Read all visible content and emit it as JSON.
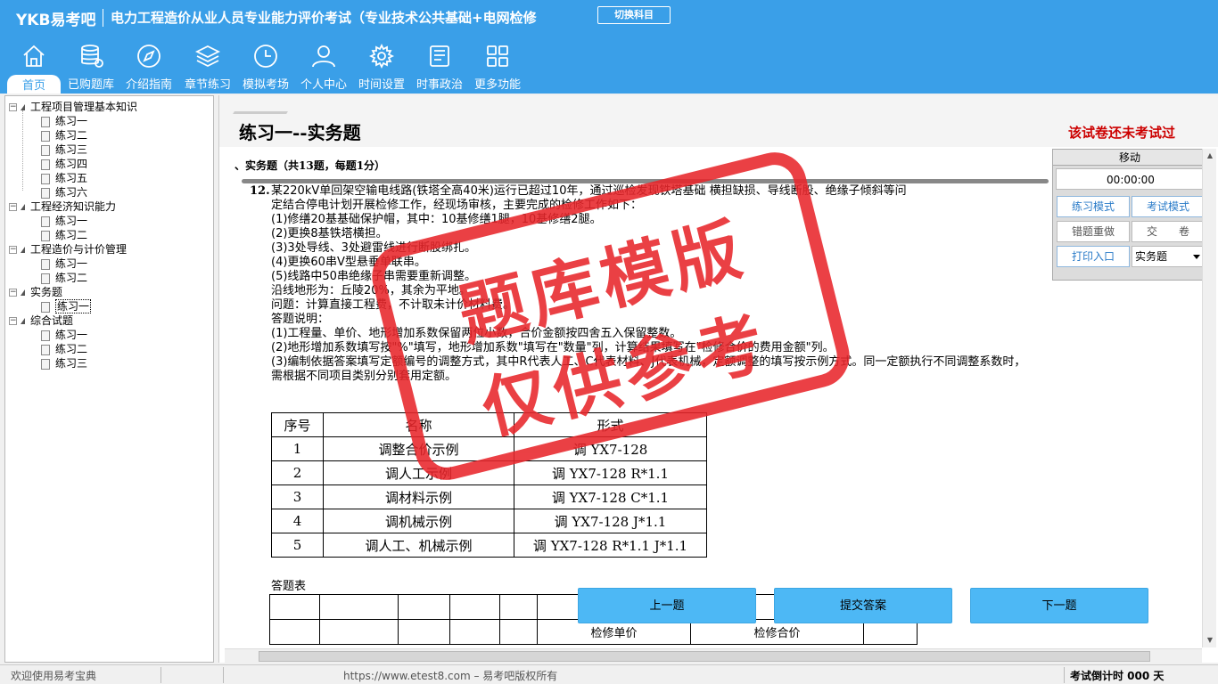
{
  "header": {
    "logo": "YKB易考吧",
    "title": "电力工程造价从业人员专业能力评价考试（专业技术公共基础+电网检修",
    "switch_label": "切换科目",
    "nav": [
      {
        "label": "首页",
        "icon": "home-icon",
        "active": true
      },
      {
        "label": "已购题库",
        "icon": "database-icon"
      },
      {
        "label": "介绍指南",
        "icon": "compass-icon"
      },
      {
        "label": "章节练习",
        "icon": "layers-icon"
      },
      {
        "label": "模拟考场",
        "icon": "clock-icon"
      },
      {
        "label": "个人中心",
        "icon": "user-icon"
      },
      {
        "label": "时间设置",
        "icon": "gear-icon"
      },
      {
        "label": "时事政治",
        "icon": "news-icon"
      },
      {
        "label": "更多功能",
        "icon": "grid-icon"
      }
    ]
  },
  "sidebar": {
    "groups": [
      {
        "label": "工程项目管理基本知识",
        "items": [
          "练习一",
          "练习二",
          "练习三",
          "练习四",
          "练习五",
          "练习六"
        ]
      },
      {
        "label": "工程经济知识能力",
        "items": [
          "练习一",
          "练习二"
        ]
      },
      {
        "label": "工程造价与计价管理",
        "items": [
          "练习一",
          "练习二"
        ]
      },
      {
        "label": "实务题",
        "items": [
          "练习一"
        ]
      },
      {
        "label": "综合试题",
        "items": [
          "练习一",
          "练习二",
          "练习三"
        ]
      }
    ],
    "selected": "实务题/练习一"
  },
  "content": {
    "paper_title": "练习一--实务题",
    "status": "该试卷还未考试过",
    "section_title": "、实务题（共13题，每题1分）",
    "question": {
      "number": "12.",
      "lines": [
        "某220kV单回架空输电线路(铁塔全高40米)运行已超过10年，通过巡检发现铁塔基础              横担缺损、导线断股、绝缘子倾斜等问",
        "定结合停电计划开展检修工作，经现场审核，主要完成的检修工作如下：",
        "(1)修缮20基基础保护帽，其中：10基修缮1腿，10基修缮2腿。",
        "(2)更换8基铁塔横担。",
        "(3)3处导线、3处避雷线进行断股绑扎。",
        "(4)更换60串V型悬垂单联串。",
        "(5)线路中50串绝缘子串需要重新调整。",
        "沿线地形为：丘陵20%，其余为平地。",
        "问题：计算直接工程费，不计取未计价材料费。",
        "答题说明：",
        "(1)工程量、单价、地形增加系数保留两位小数，合价金额按四舍五入保留整数。",
        "(2)地形增加系数填写按\"%\"填写，地形增加系数\"填写在\"数量\"列，计算结果填写在\"检修合价的费用金额\"列。",
        "(3)编制依据答案填写定额编号的调整方式，其中R代表人工、C代表材料、J代表机械，定额调整的填写按示例方式。同一定额执行不同调整系数时，",
        "需根据不同项目类别分别套用定额。"
      ],
      "sample_table": {
        "headers": [
          "序号",
          "名称",
          "形式"
        ],
        "rows": [
          [
            "1",
            "调整合价示例",
            "调 YX7-128"
          ],
          [
            "2",
            "调人工示例",
            "调 YX7-128 R*1.1"
          ],
          [
            "3",
            "调材料示例",
            "调 YX7-128 C*1.1"
          ],
          [
            "4",
            "调机械示例",
            "调 YX7-128 J*1.1"
          ],
          [
            "5",
            "调人工、机械示例",
            "调 YX7-128 R*1.1 J*1.1"
          ]
        ]
      },
      "answer_label": "答题表",
      "answer_table_headers": [
        "检修单价",
        "检修合价"
      ]
    },
    "buttons": {
      "prev": "上一题",
      "submit": "提交答案",
      "next": "下一题"
    }
  },
  "right_panel": {
    "header": "移动",
    "timer": "00:00:00",
    "practice_mode": "练习模式",
    "exam_mode": "考试模式",
    "redo_wrong": "错题重做",
    "submit_paper": "交　　卷",
    "print": "打印入口",
    "select_value": "实务题"
  },
  "watermark": {
    "line1": "题库模版",
    "line2": "仅供参考"
  },
  "statusbar": {
    "welcome": "欢迎使用易考宝典",
    "copyright": "https://www.etest8.com – 易考吧版权所有",
    "countdown": "考试倒计时 000 天"
  }
}
